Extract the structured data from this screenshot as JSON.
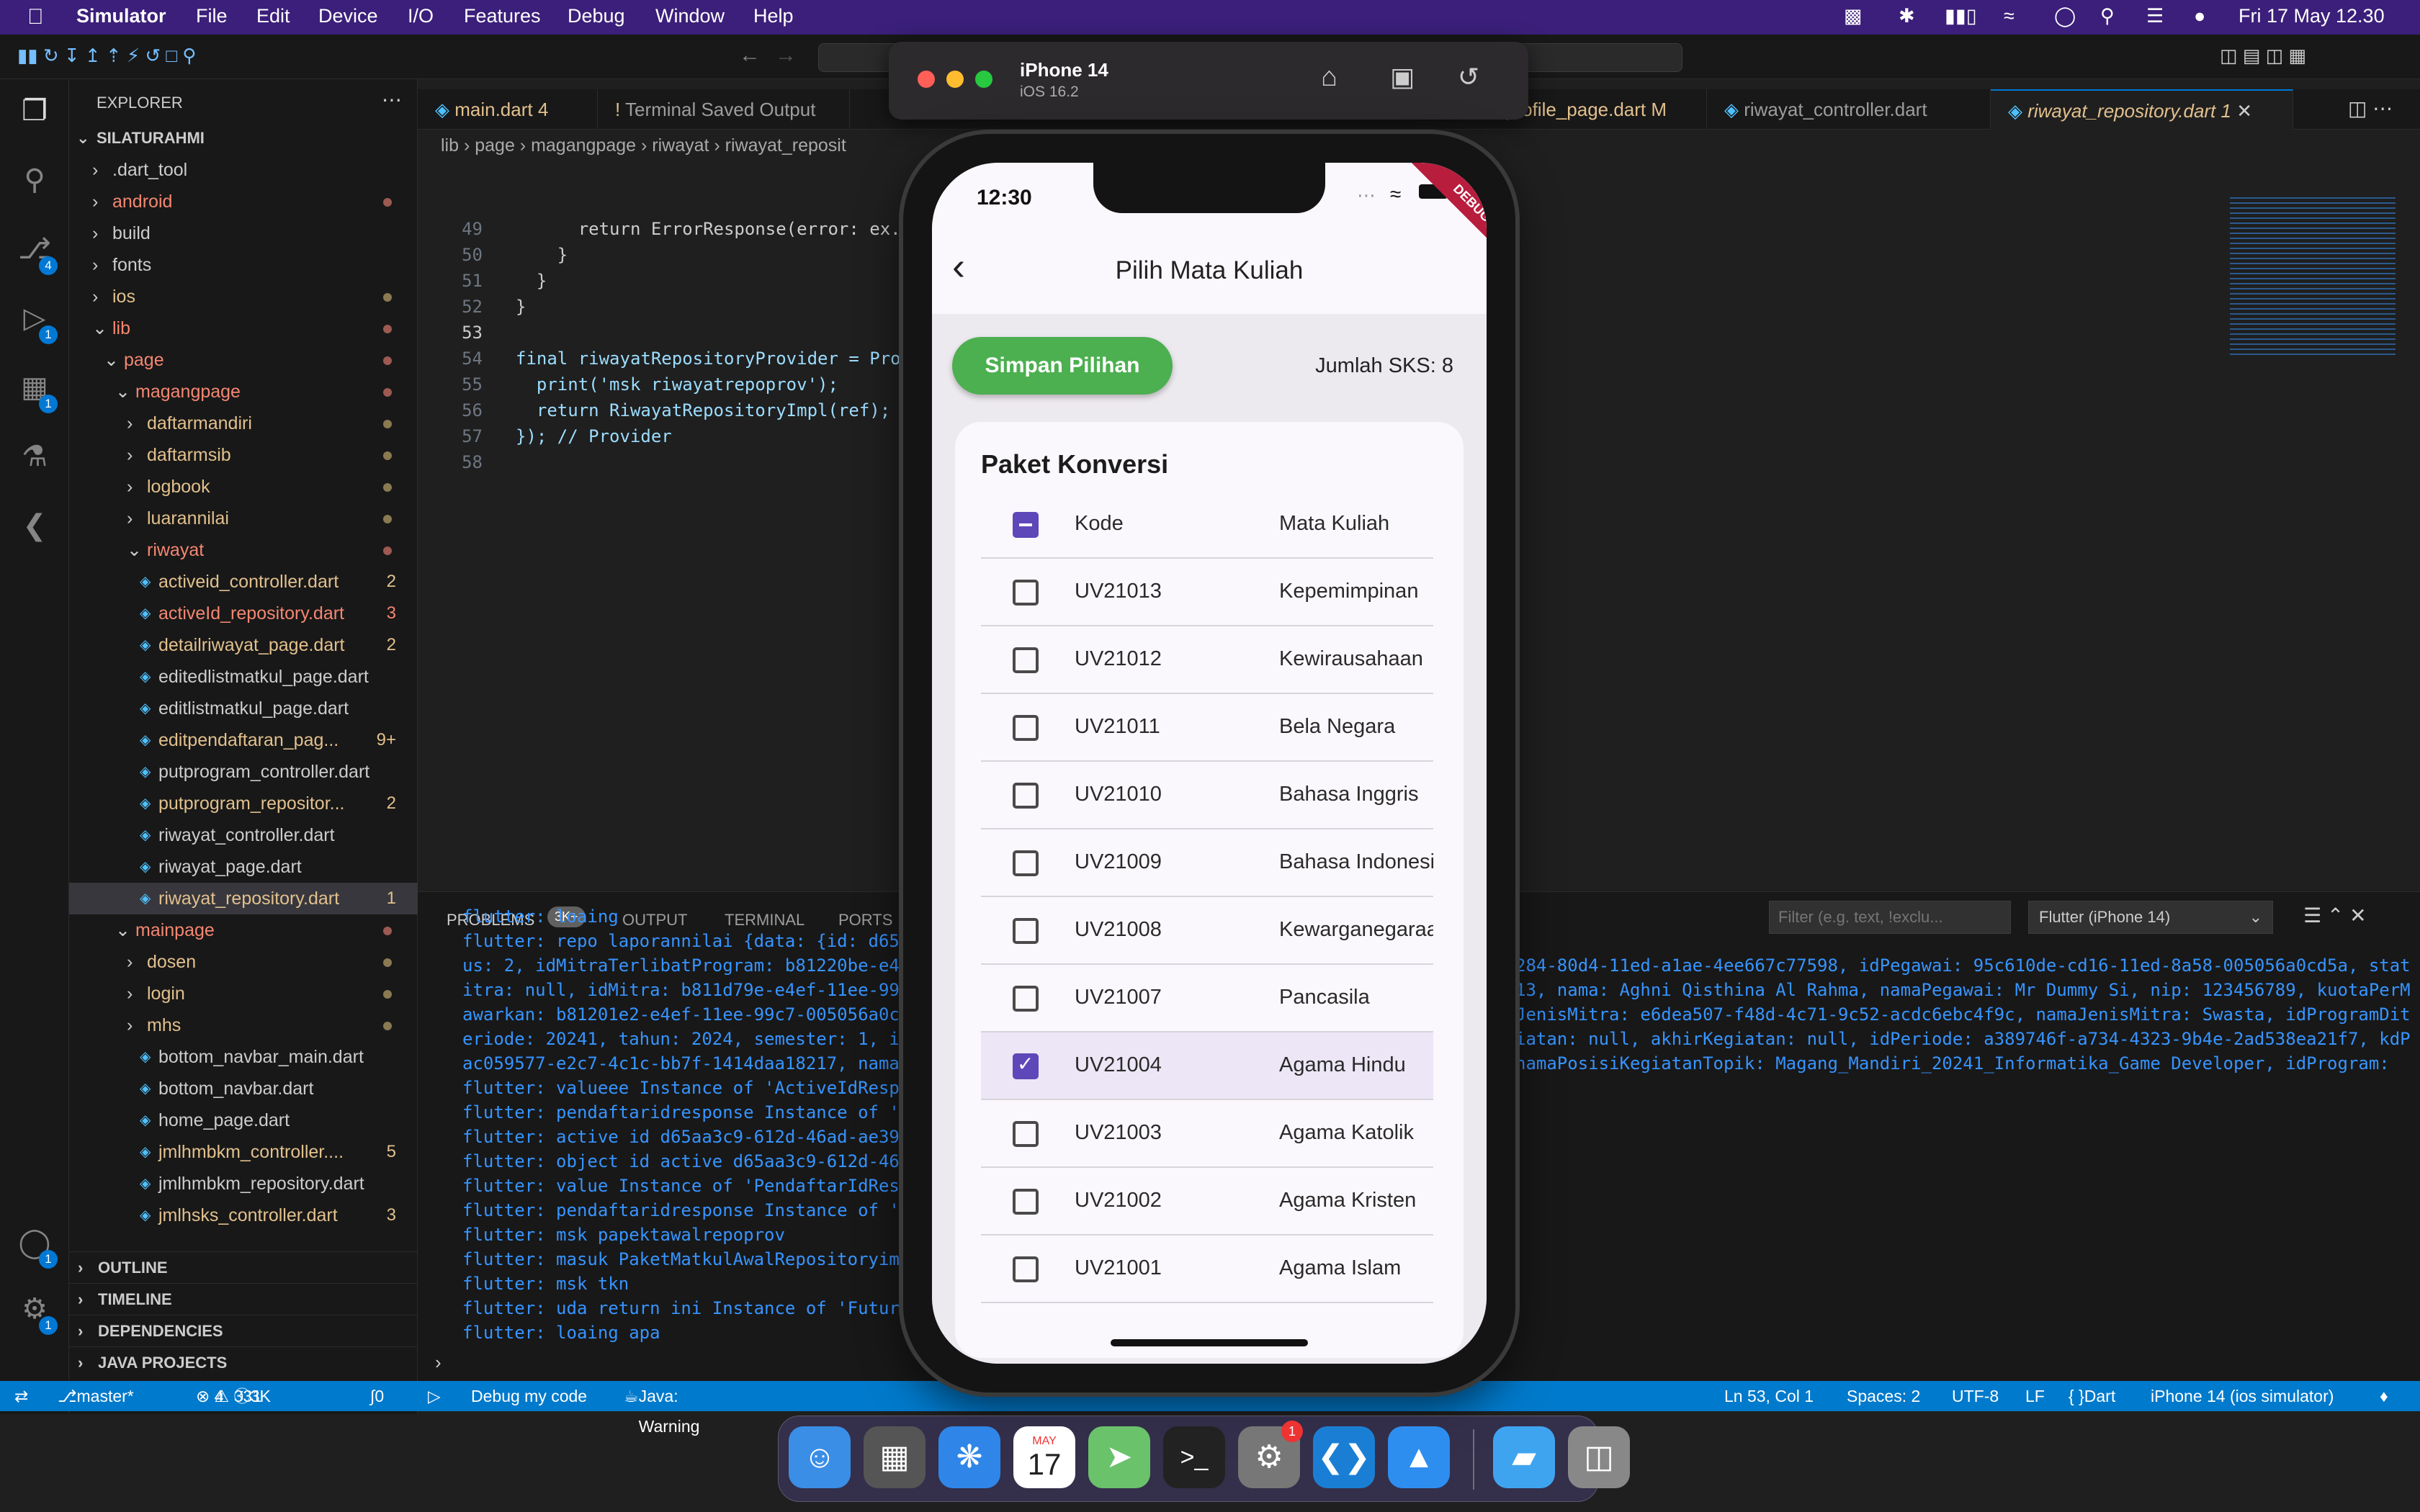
{
  "menubar": {
    "app": "Simulator",
    "menus": [
      "File",
      "Edit",
      "Device",
      "I/O",
      "Features",
      "Debug",
      "Window",
      "Help"
    ],
    "clock": "Fri 17 May  12.30"
  },
  "simulator": {
    "device": "iPhone 14",
    "os": "iOS 16.2"
  },
  "explorer": {
    "title": "EXPLORER",
    "root": "SILATURAHMI",
    "items": [
      {
        "label": ".dart_tool",
        "color": "#cccccc"
      },
      {
        "label": "android",
        "color": "#f48771"
      },
      {
        "label": "build",
        "color": "#cccccc"
      },
      {
        "label": "fonts",
        "color": "#cccccc"
      },
      {
        "label": "ios",
        "color": "#e2c08d"
      },
      {
        "label": "lib",
        "color": "#f48771"
      },
      {
        "label": "page",
        "color": "#f48771"
      },
      {
        "label": "magangpage",
        "color": "#f48771"
      },
      {
        "label": "daftarmandiri",
        "color": "#e2c08d"
      },
      {
        "label": "daftarmsib",
        "color": "#e2c08d"
      },
      {
        "label": "logbook",
        "color": "#e2c08d"
      },
      {
        "label": "luarannilai",
        "color": "#e2c08d"
      },
      {
        "label": "riwayat",
        "color": "#f48771"
      },
      {
        "label": "activeid_controller.dart",
        "color": "#e2c08d",
        "count": "2"
      },
      {
        "label": "activeId_repository.dart",
        "color": "#f48771",
        "count": "3"
      },
      {
        "label": "detailriwayat_page.dart",
        "color": "#e2c08d",
        "count": "2"
      },
      {
        "label": "editedlistmatkul_page.dart",
        "color": "#cccccc"
      },
      {
        "label": "editlistmatkul_page.dart",
        "color": "#cccccc"
      },
      {
        "label": "editpendaftaran_pag...",
        "color": "#e2c08d",
        "count": "9+"
      },
      {
        "label": "putprogram_controller.dart",
        "color": "#cccccc"
      },
      {
        "label": "putprogram_repositor...",
        "color": "#e2c08d",
        "count": "2"
      },
      {
        "label": "riwayat_controller.dart",
        "color": "#cccccc"
      },
      {
        "label": "riwayat_page.dart",
        "color": "#cccccc"
      },
      {
        "label": "riwayat_repository.dart",
        "color": "#e2c08d",
        "count": "1"
      },
      {
        "label": "mainpage",
        "color": "#f48771"
      },
      {
        "label": "dosen",
        "color": "#e2c08d"
      },
      {
        "label": "login",
        "color": "#e2c08d"
      },
      {
        "label": "mhs",
        "color": "#e2c08d"
      },
      {
        "label": "bottom_navbar_main.dart",
        "color": "#cccccc"
      },
      {
        "label": "bottom_navbar.dart",
        "color": "#cccccc"
      },
      {
        "label": "home_page.dart",
        "color": "#cccccc"
      },
      {
        "label": "jmlhmbkm_controller....",
        "color": "#e2c08d",
        "count": "5"
      },
      {
        "label": "jmlhmbkm_repository.dart",
        "color": "#cccccc"
      },
      {
        "label": "jmlhsks_controller.dart",
        "color": "#e2c08d",
        "count": "3"
      }
    ],
    "sections": [
      "OUTLINE",
      "TIMELINE",
      "DEPENDENCIES",
      "JAVA PROJECTS"
    ]
  },
  "tabs": [
    {
      "label": "main.dart",
      "extra": "4"
    },
    {
      "label": "Terminal Saved Output",
      "extra": ""
    },
    {
      "label": "profile_page.dart",
      "extra": "M"
    },
    {
      "label": "riwayat_controller.dart",
      "extra": ""
    },
    {
      "label": "riwayat_repository.dart",
      "extra": "1"
    }
  ],
  "breadcrumb": [
    "lib",
    "page",
    "magangpage",
    "riwayat",
    "riwayat_reposit"
  ],
  "code": [
    {
      "n": "49",
      "t": "      return ErrorResponse(error: ex.e"
    },
    {
      "n": "50",
      "t": "    }"
    },
    {
      "n": "51",
      "t": "  }"
    },
    {
      "n": "52",
      "t": "}"
    },
    {
      "n": "53",
      "t": ""
    },
    {
      "n": "54",
      "t": "final riwayatRepositoryProvider = Prov"
    },
    {
      "n": "55",
      "t": "  print('msk riwayatrepoprov');"
    },
    {
      "n": "56",
      "t": "  return RiwayatRepositoryImpl(ref);"
    },
    {
      "n": "57",
      "t": "}); // Provider"
    },
    {
      "n": "58",
      "t": ""
    }
  ],
  "panel": {
    "tabs": [
      "PROBLEMS",
      "OUTPUT",
      "TERMINAL",
      "PORTS"
    ],
    "problems_badge": "3K+",
    "filter_placeholder": "Filter (e.g. text, !exclu...",
    "device_select": "Flutter (iPhone 14)",
    "left_lines": [
      "flutter: loaing",
      "flutter: repo laporannilai {data: {id: d65",
      "us: 2, idMitraTerlibatProgram: b81220be-e4",
      "itra: null, idMitra: b811d79e-e4ef-11ee-99",
      "awarkan: b81201e2-e4ef-11ee-99c7-005056a0c",
      "eriode: 20241, tahun: 2024, semester: 1, i",
      "ac059577-e2c7-4c1c-bb7f-1414daa18217, namaP",
      "flutter: valueee Instance of 'ActiveIdResp",
      "flutter: pendaftaridresponse Instance of '",
      "flutter: active id d65aa3c9-612d-46ad-ae39",
      "flutter: object id active d65aa3c9-612d-46",
      "flutter: value Instance of 'PendaftarIdRes",
      "flutter: pendaftaridresponse Instance of '",
      "flutter: msk papektawalrepoprov",
      "flutter: masuk PaketMatkulAwalRepositoryim",
      "flutter: msk tkn",
      "flutter: uda return ini Instance of 'Future",
      "flutter: loaing apa"
    ],
    "right_lines": [
      "",
      "",
      "284-80d4-11ed-a1ae-4ee667c77598, idPegawai: 95c610de-cd16-11ed-8a58-005056a0cd5a, stat",
      "13, nama: Aghni Qisthina Al Rahma, namaPegawai: Mr Dummy Si, nip: 123456789, kuotaPerM",
      "JenisMitra: e6dea507-f48d-4c71-9c52-acdc6ebc4f9c, namaJenisMitra: Swasta, idProgramDit",
      "iatan: null, akhirKegiatan: null, idPeriode: a389746f-a734-4323-9b4e-2ad538ea21f7, kdP",
      "namaPosisiKegiatanTopik: Magang_Mandiri_20241_Informatika_Game Developer, idProgram:"
    ]
  },
  "status": {
    "branch": "master*",
    "errors": "4",
    "warnings": "331",
    "info": "3K",
    "ports": "0",
    "debug": "Debug my code",
    "java": "Java: Warning",
    "position": "Ln 53, Col 1",
    "spaces": "Spaces: 2",
    "encoding": "UTF-8",
    "eol": "LF",
    "lang": "Dart",
    "device": "iPhone 14 (ios simulator)"
  },
  "app": {
    "time": "12:30",
    "debug_banner": "DEBUG",
    "title": "Pilih Mata Kuliah",
    "save_button": "Simpan Pilihan",
    "sks": "Jumlah SKS: 8",
    "card_title": "Paket Konversi",
    "header": {
      "kode": "Kode",
      "mk": "Mata Kuliah"
    },
    "rows": [
      {
        "kode": "UV21013",
        "mk": "Kepemimpinan",
        "checked": false
      },
      {
        "kode": "UV21012",
        "mk": "Kewirausahaan",
        "checked": false
      },
      {
        "kode": "UV21011",
        "mk": "Bela Negara",
        "checked": false
      },
      {
        "kode": "UV21010",
        "mk": "Bahasa Inggris",
        "checked": false
      },
      {
        "kode": "UV21009",
        "mk": "Bahasa Indonesia",
        "checked": false
      },
      {
        "kode": "UV21008",
        "mk": "Kewarganegaraan",
        "checked": false
      },
      {
        "kode": "UV21007",
        "mk": "Pancasila",
        "checked": false
      },
      {
        "kode": "UV21004",
        "mk": "Agama Hindu",
        "checked": true
      },
      {
        "kode": "UV21003",
        "mk": "Agama Katolik",
        "checked": false
      },
      {
        "kode": "UV21002",
        "mk": "Agama Kristen",
        "checked": false
      },
      {
        "kode": "UV21001",
        "mk": "Agama Islam",
        "checked": false
      }
    ]
  },
  "dock": {
    "calendar_month": "MAY",
    "calendar_day": "17",
    "settings_badge": "1"
  },
  "colors": {
    "accent": "#5e47b8",
    "button": "#4caf50",
    "statusbar": "#007acc",
    "menubar": "#3b1f7a"
  }
}
